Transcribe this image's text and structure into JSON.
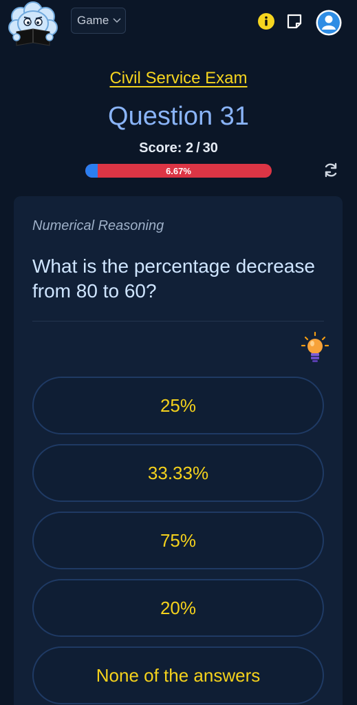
{
  "header": {
    "game_dropdown": {
      "label": "Game",
      "icon": "chevron-down-icon"
    },
    "icons": [
      "info-icon",
      "notes-icon",
      "user-avatar-icon"
    ],
    "accent_color": "#f6d51f"
  },
  "exam": {
    "title": "Civil Service Exam",
    "question_label": "Question 31",
    "score_label": "Score:",
    "score_value": "2",
    "score_total": "30",
    "progress_text": "6.67%",
    "progress_fraction": 0.0667
  },
  "question": {
    "category": "Numerical Reasoning",
    "text": "What is the percentage decrease from 80 to 60?",
    "hint_icon": "lightbulb-icon"
  },
  "answers": [
    {
      "label": "25%"
    },
    {
      "label": "33.33%"
    },
    {
      "label": "75%"
    },
    {
      "label": "20%"
    },
    {
      "label": "None of the answers"
    }
  ]
}
